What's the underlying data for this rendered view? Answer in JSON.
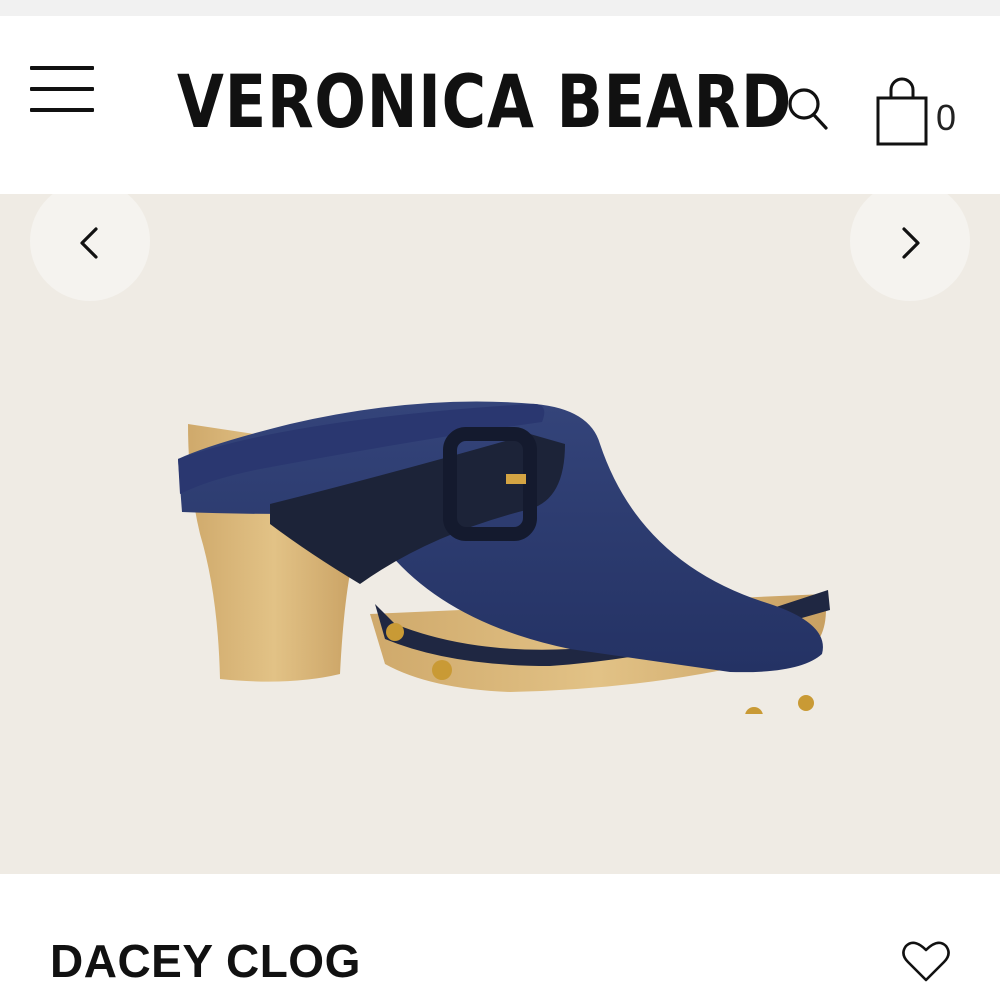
{
  "header": {
    "brand": "VERONICA BEARD",
    "icons": {
      "menu": "hamburger-menu-icon",
      "search": "search-icon",
      "bag": "shopping-bag-icon"
    },
    "bag_count": "0"
  },
  "gallery": {
    "prev_icon": "chevron-left-icon",
    "next_icon": "chevron-right-icon",
    "image_alt": "Dacey Clog in denim with wooden heel"
  },
  "product": {
    "name": "DACEY CLOG",
    "wishlist_icon": "heart-icon"
  },
  "colors": {
    "gallery_bg": "#efebe4",
    "denim": "#2c3a6e",
    "wood": "#d8b57a",
    "stud": "#c99a35"
  }
}
